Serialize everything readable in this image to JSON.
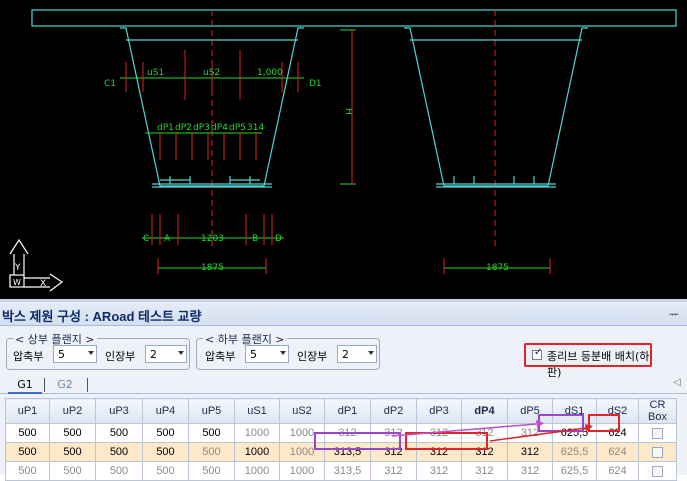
{
  "drawing": {
    "left_box": {
      "top_labels": [
        "uS1",
        "uS2",
        "1,000"
      ],
      "side_labels": [
        "C1",
        "D1",
        "H"
      ],
      "web_labels": [
        "dP1",
        "dP2",
        "dP3",
        "dP4",
        "dP5",
        "314"
      ],
      "bottom_labels": [
        "C",
        "A",
        "1203",
        "B",
        "D"
      ],
      "width_label": "1875"
    },
    "right_box": {
      "width_label": "1875"
    },
    "ucs": {
      "y": "Y",
      "w": "W",
      "x": "X"
    }
  },
  "panel": {
    "title": "박스 제원 구성 : ARoad 테스트 교량",
    "pin": "ᅲ",
    "upper_flange": {
      "title": "< 상부 플랜지 >",
      "compress_label": "압축부",
      "compress_value": "5",
      "tension_label": "인장부",
      "tension_value": "2"
    },
    "lower_flange": {
      "title": "< 하부 플랜지 >",
      "compress_label": "압축부",
      "compress_value": "5",
      "tension_label": "인장부",
      "tension_value": "2"
    },
    "checkbox": {
      "mark": "✓",
      "label": "종리브 등분배 배치(하판)"
    },
    "tabs": [
      "G1",
      "G2"
    ],
    "tab_scroll": "◁",
    "table": {
      "headers": [
        "uP1",
        "uP2",
        "uP3",
        "uP4",
        "uP5",
        "uS1",
        "uS2",
        "dP1",
        "dP2",
        "dP3",
        "dP4",
        "dP5",
        "dS1",
        "dS2",
        "CR Box"
      ],
      "rows": [
        [
          "500",
          "500",
          "500",
          "500",
          "500",
          "1000",
          "1000",
          "312",
          "312",
          "312",
          "312",
          "312",
          "625,5",
          "624",
          ""
        ],
        [
          "500",
          "500",
          "500",
          "500",
          "500",
          "1000",
          "1000",
          "313,5",
          "312",
          "312",
          "312",
          "312",
          "625,5",
          "624",
          ""
        ],
        [
          "500",
          "500",
          "500",
          "500",
          "500",
          "1000",
          "1000",
          "313,5",
          "312",
          "312",
          "312",
          "312",
          "625,5",
          "624",
          ""
        ]
      ]
    }
  },
  "colors": {
    "cad_bg": "#000000",
    "cad_line": "#4fd6d6",
    "dim_green": "#27d927",
    "dim_red": "#e02020",
    "highlight_red": "#e0242a",
    "highlight_purple": "#9a46c8",
    "row_alt": "#fde9c8"
  },
  "icons": [
    "ucs-icon",
    "pin-icon",
    "dropdown-arrow-icon",
    "checkbox-icon"
  ]
}
